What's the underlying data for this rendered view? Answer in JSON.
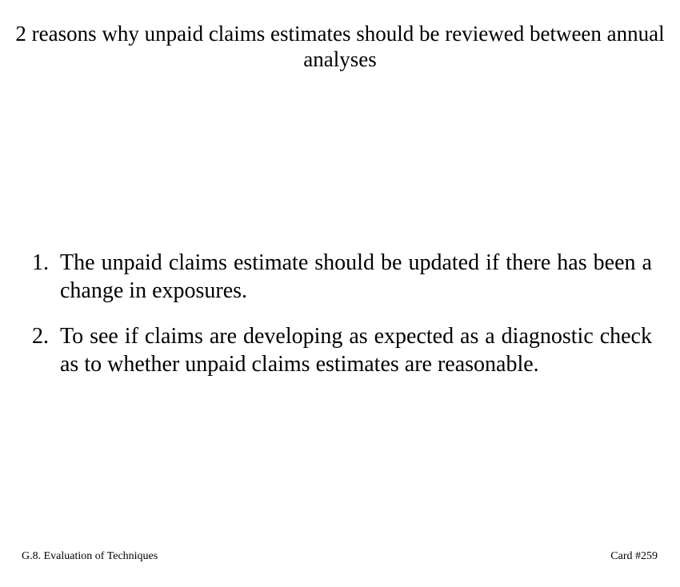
{
  "card": {
    "title": "2 reasons why unpaid claims estimates should be reviewed between annual analyses",
    "items": [
      {
        "number": "1.",
        "text": "The unpaid claims estimate should be updated if there has been a change in exposures."
      },
      {
        "number": "2.",
        "text": "To see if claims are developing as expected as a diagnostic check as to whether unpaid claims estimates are reasonable."
      }
    ],
    "footer": {
      "section": "G.8. Evaluation of Techniques",
      "card_number": "Card #259"
    }
  }
}
